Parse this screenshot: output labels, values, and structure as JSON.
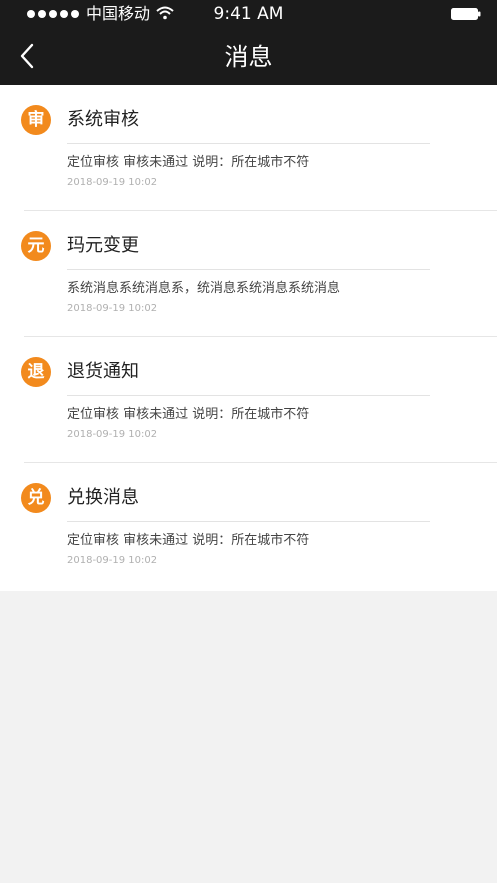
{
  "status_bar": {
    "carrier": "中国移动",
    "time": "9:41 AM",
    "signal_icon": "signal-dots-icon",
    "wifi_icon": "wifi-icon",
    "battery_icon": "battery-icon"
  },
  "nav": {
    "title": "消息",
    "back_icon": "chevron-left-icon"
  },
  "colors": {
    "header_bg": "#1b1b1b",
    "badge": "#f28a1d",
    "page_bg": "#f2f2f2"
  },
  "messages": [
    {
      "badge": "审",
      "title": "系统审核",
      "content": "定位审核 审核未通过 说明：所在城市不符",
      "time": "2018-09-19  10:02"
    },
    {
      "badge": "元",
      "title": "玛元变更",
      "content": "系统消息系统消息系，统消息系统消息系统消息",
      "time": "2018-09-19  10:02"
    },
    {
      "badge": "退",
      "title": "退货通知",
      "content": "定位审核 审核未通过 说明：所在城市不符",
      "time": "2018-09-19  10:02"
    },
    {
      "badge": "兑",
      "title": "兑换消息",
      "content": "定位审核 审核未通过 说明：所在城市不符",
      "time": "2018-09-19  10:02"
    }
  ]
}
